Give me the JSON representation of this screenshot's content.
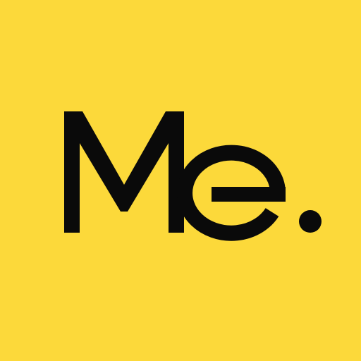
{
  "app_icon": {
    "logo_text": "Me.",
    "background_color": "#FCD93A",
    "text_color": "#0A0A0A"
  }
}
